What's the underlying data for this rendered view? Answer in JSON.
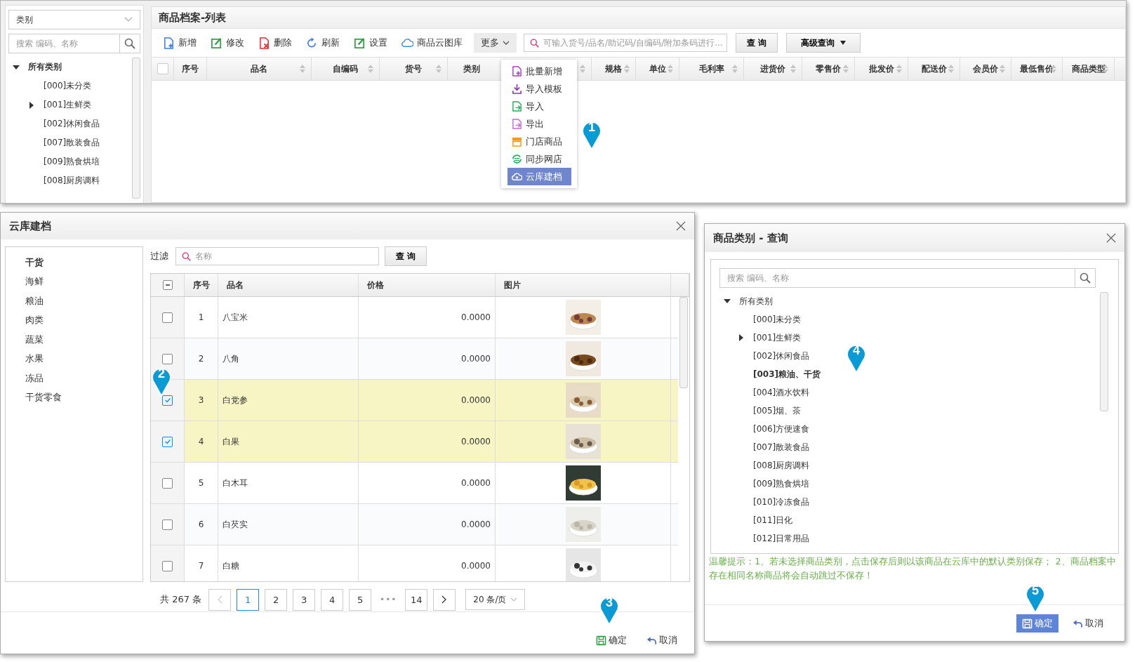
{
  "product_list": {
    "sidebar": {
      "category_select": "类别",
      "search_placeholder": "搜索 编码、名称",
      "tree": {
        "label": "所有类别",
        "expanded": true,
        "children": [
          {
            "label": "[000]未分类"
          },
          {
            "label": "[001]生鲜类",
            "expanded": false
          },
          {
            "label": "[002]休闲食品"
          },
          {
            "label": "[007]散装食品"
          },
          {
            "label": "[009]熟食烘培"
          },
          {
            "label": "[008]厨房调料"
          }
        ]
      }
    },
    "title": "商品档案-列表",
    "toolbar": [
      {
        "label": "新增",
        "kind": "add"
      },
      {
        "label": "修改",
        "kind": "edit"
      },
      {
        "label": "删除",
        "kind": "delete"
      },
      {
        "label": "刷新",
        "kind": "refresh"
      },
      {
        "label": "设置",
        "kind": "settings"
      },
      {
        "label": "商品云图库",
        "kind": "cloud"
      }
    ],
    "more_button": {
      "label": "更多",
      "expanded": true
    },
    "search_placeholder": "可输入货号/品名/助记码/自编码/附加条码进行...",
    "query_button": "查 询",
    "advanced_button": "高级查询",
    "select_all_checked": false,
    "columns": [
      {
        "label": "序号",
        "sortable": false
      },
      {
        "label": "品名",
        "sortable": true
      },
      {
        "label": "自编码",
        "sortable": true
      },
      {
        "label": "货号",
        "sortable": true
      },
      {
        "label": "类别",
        "sortable": true
      },
      {
        "label": "规格",
        "sortable": true
      },
      {
        "label": "单位",
        "sortable": true
      },
      {
        "label": "毛利率",
        "sortable": true
      },
      {
        "label": "进货价",
        "sortable": true
      },
      {
        "label": "零售价",
        "sortable": true
      },
      {
        "label": "批发价",
        "sortable": true
      },
      {
        "label": "配送价",
        "sortable": true
      },
      {
        "label": "会员价",
        "sortable": true
      },
      {
        "label": "最低售价",
        "sortable": true
      },
      {
        "label": "商品类型",
        "sortable": true
      }
    ],
    "more_menu": [
      {
        "label": "批量新增",
        "kind": "batch",
        "selected": false
      },
      {
        "label": "导入模板",
        "kind": "template",
        "selected": false
      },
      {
        "label": "导入",
        "kind": "import",
        "selected": false
      },
      {
        "label": "导出",
        "kind": "export",
        "selected": false
      },
      {
        "label": "门店商品",
        "kind": "store",
        "selected": false
      },
      {
        "label": "同步网店",
        "kind": "sync",
        "selected": false
      },
      {
        "label": "云库建档",
        "kind": "cloud",
        "selected": true
      }
    ]
  },
  "cloud_dialog": {
    "title": "云库建档",
    "categories": [
      {
        "label": "干货",
        "selected": true
      },
      {
        "label": "海鲜",
        "selected": false
      },
      {
        "label": "粮油",
        "selected": false
      },
      {
        "label": "肉类",
        "selected": false
      },
      {
        "label": "蔬菜",
        "selected": false
      },
      {
        "label": "水果",
        "selected": false
      },
      {
        "label": "冻品",
        "selected": false
      },
      {
        "label": "干货零食",
        "selected": false
      }
    ],
    "filter_label": "过滤",
    "filter_placeholder": "名称",
    "query_button": "查 询",
    "header_checkbox_indeterminate": true,
    "columns": [
      "序号",
      "品名",
      "价格",
      "图片"
    ],
    "rows": [
      {
        "index": "1",
        "name": "八宝米",
        "price": "0.0000",
        "checked": false
      },
      {
        "index": "2",
        "name": "八角",
        "price": "0.0000",
        "checked": false
      },
      {
        "index": "3",
        "name": "白党参",
        "price": "0.0000",
        "checked": true
      },
      {
        "index": "4",
        "name": "白果",
        "price": "0.0000",
        "checked": true
      },
      {
        "index": "5",
        "name": "白木耳",
        "price": "0.0000",
        "checked": false
      },
      {
        "index": "6",
        "name": "白芡实",
        "price": "0.0000",
        "checked": false
      },
      {
        "index": "7",
        "name": "白糖",
        "price": "0.0000",
        "checked": false
      }
    ],
    "pagination": {
      "total": "共 267 条",
      "prev_disabled": true,
      "pages": [
        {
          "label": "1",
          "selected": true
        },
        {
          "label": "2",
          "selected": false
        },
        {
          "label": "3",
          "selected": false
        },
        {
          "label": "4",
          "selected": false
        },
        {
          "label": "5",
          "selected": false
        }
      ],
      "ellipsis": "•••",
      "last_page": "14",
      "page_size": "20 条/页"
    },
    "confirm_button": "确定",
    "cancel_button": "取消"
  },
  "category_dialog": {
    "title": "商品类别 - 查询",
    "search_placeholder": "搜索 编码、名称",
    "tree": {
      "label": "所有类别",
      "expanded": true,
      "children": [
        {
          "label": "[000]未分类",
          "selected": false
        },
        {
          "label": "[001]生鲜类",
          "expanded": false,
          "selected": false
        },
        {
          "label": "[002]休闲食品",
          "selected": false
        },
        {
          "label": "[003]粮油、干货",
          "selected": true
        },
        {
          "label": "[004]酒水饮料",
          "selected": false
        },
        {
          "label": "[005]烟、茶",
          "selected": false
        },
        {
          "label": "[006]方便速食",
          "selected": false
        },
        {
          "label": "[007]散装食品",
          "selected": false
        },
        {
          "label": "[008]厨房调料",
          "selected": false
        },
        {
          "label": "[009]熟食烘培",
          "selected": false
        },
        {
          "label": "[010]冷冻食品",
          "selected": false
        },
        {
          "label": "[011]日化",
          "selected": false
        },
        {
          "label": "[012]日常用品",
          "selected": false
        }
      ]
    },
    "hint": "温馨提示：1、若未选择商品类别，点击保存后则以该商品在云库中的默认类别保存； 2、商品档案中存在相同名称商品将会自动跳过不保存！",
    "confirm_button": "确定",
    "cancel_button": "取消"
  },
  "callouts": [
    {
      "number": "1"
    },
    {
      "number": "2"
    },
    {
      "number": "3"
    },
    {
      "number": "4"
    },
    {
      "number": "5"
    }
  ]
}
